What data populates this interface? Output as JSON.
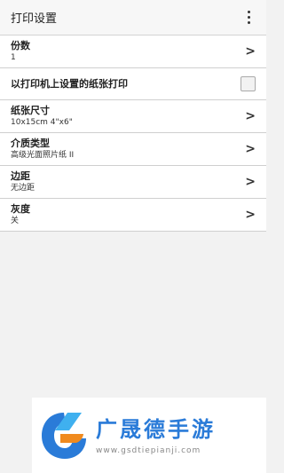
{
  "header": {
    "title": "打印设置",
    "menu_icon": "more-vertical-icon"
  },
  "settings": [
    {
      "label": "份数",
      "value": "1"
    },
    {
      "label": "以打印机上设置的纸张打印",
      "checked": false
    },
    {
      "label": "纸张尺寸",
      "value": "10x15cm 4\"x6\""
    },
    {
      "label": "介质类型",
      "value": "高级光面照片纸 II"
    },
    {
      "label": "边距",
      "value": "无边距"
    },
    {
      "label": "灰度",
      "value": "关"
    }
  ],
  "watermark": {
    "brand": "广晟德手游",
    "url": "www.gsdtiepianji.com"
  },
  "colors": {
    "brand": "#2a7bd8",
    "logo_orange": "#f08a1e"
  }
}
